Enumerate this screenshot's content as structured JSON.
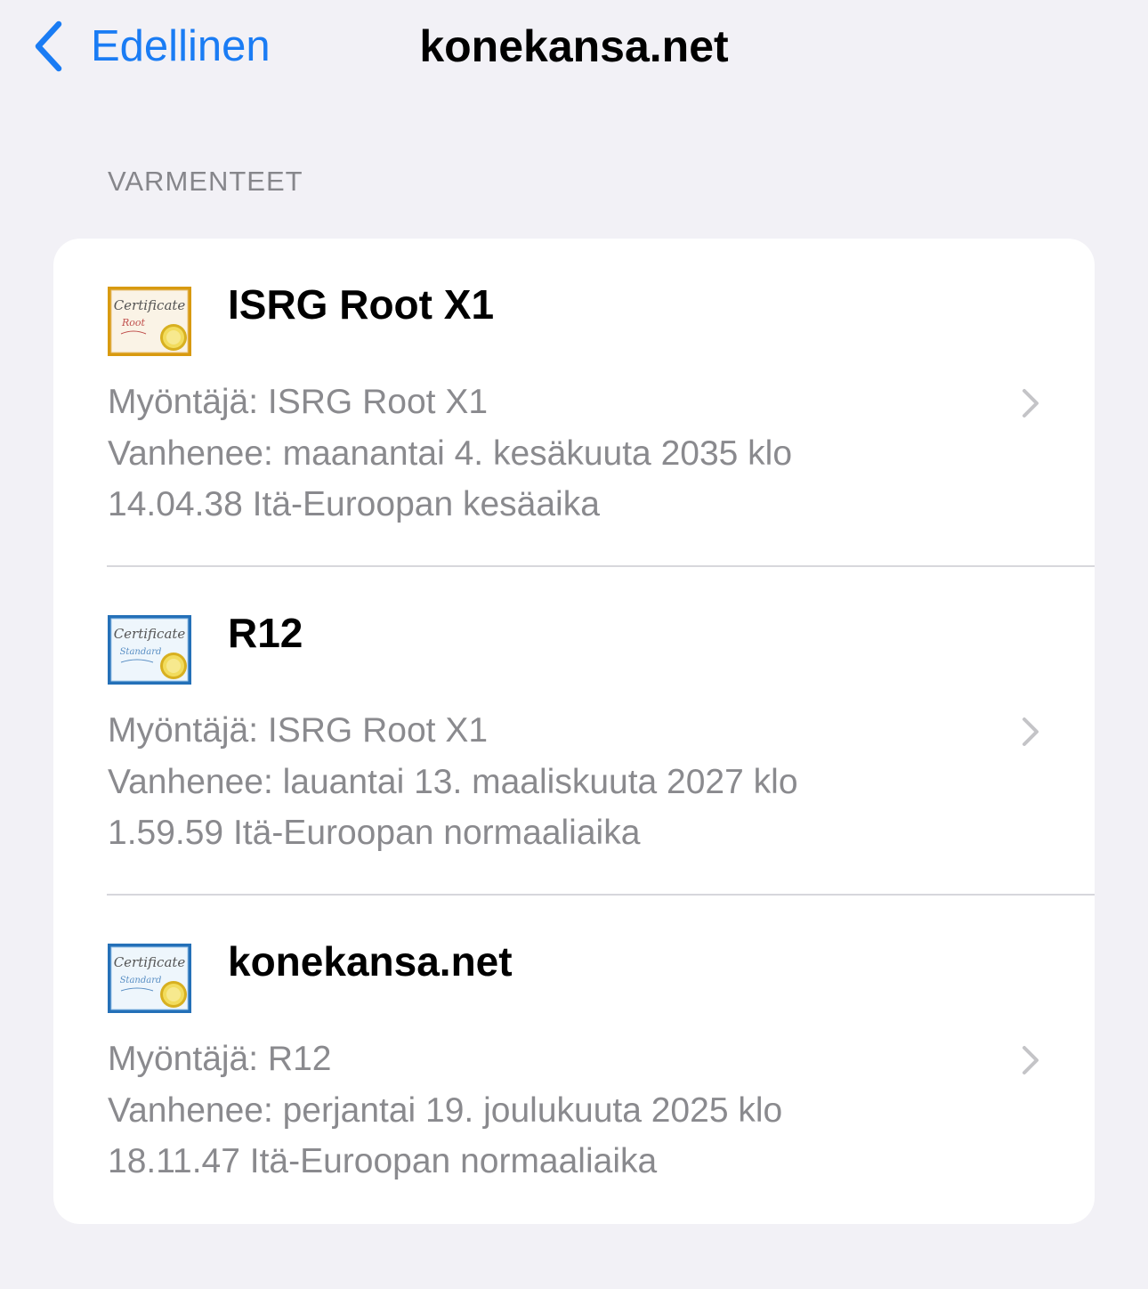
{
  "navbar": {
    "back_label": "Edellinen",
    "title": "konekansa.net"
  },
  "section_header": "VARMENTEET",
  "colors": {
    "accent": "#1a7cf4",
    "background": "#f2f1f6",
    "secondary_text": "#8a8a8e",
    "root_cert_frame": "#d89a10",
    "standard_cert_frame": "#2470b8"
  },
  "certificates": [
    {
      "title": "ISRG Root X1",
      "icon": "certificate-root-icon",
      "icon_text": {
        "heading": "Certificate",
        "kind": "Root"
      },
      "issuer": "Myöntäjä: ISRG Root X1",
      "expires_line1": "Vanhenee: maanantai 4. kesäkuuta 2035 klo",
      "expires_line2": "14.04.38 Itä-Euroopan kesäaika"
    },
    {
      "title": "R12",
      "icon": "certificate-standard-icon",
      "icon_text": {
        "heading": "Certificate",
        "kind": "Standard"
      },
      "issuer": "Myöntäjä: ISRG Root X1",
      "expires_line1": "Vanhenee: lauantai 13. maaliskuuta 2027 klo",
      "expires_line2": "1.59.59 Itä-Euroopan normaaliaika"
    },
    {
      "title": "konekansa.net",
      "icon": "certificate-standard-icon",
      "icon_text": {
        "heading": "Certificate",
        "kind": "Standard"
      },
      "issuer": "Myöntäjä: R12",
      "expires_line1": "Vanhenee: perjantai 19. joulukuuta 2025 klo",
      "expires_line2": "18.11.47 Itä-Euroopan normaaliaika"
    }
  ]
}
